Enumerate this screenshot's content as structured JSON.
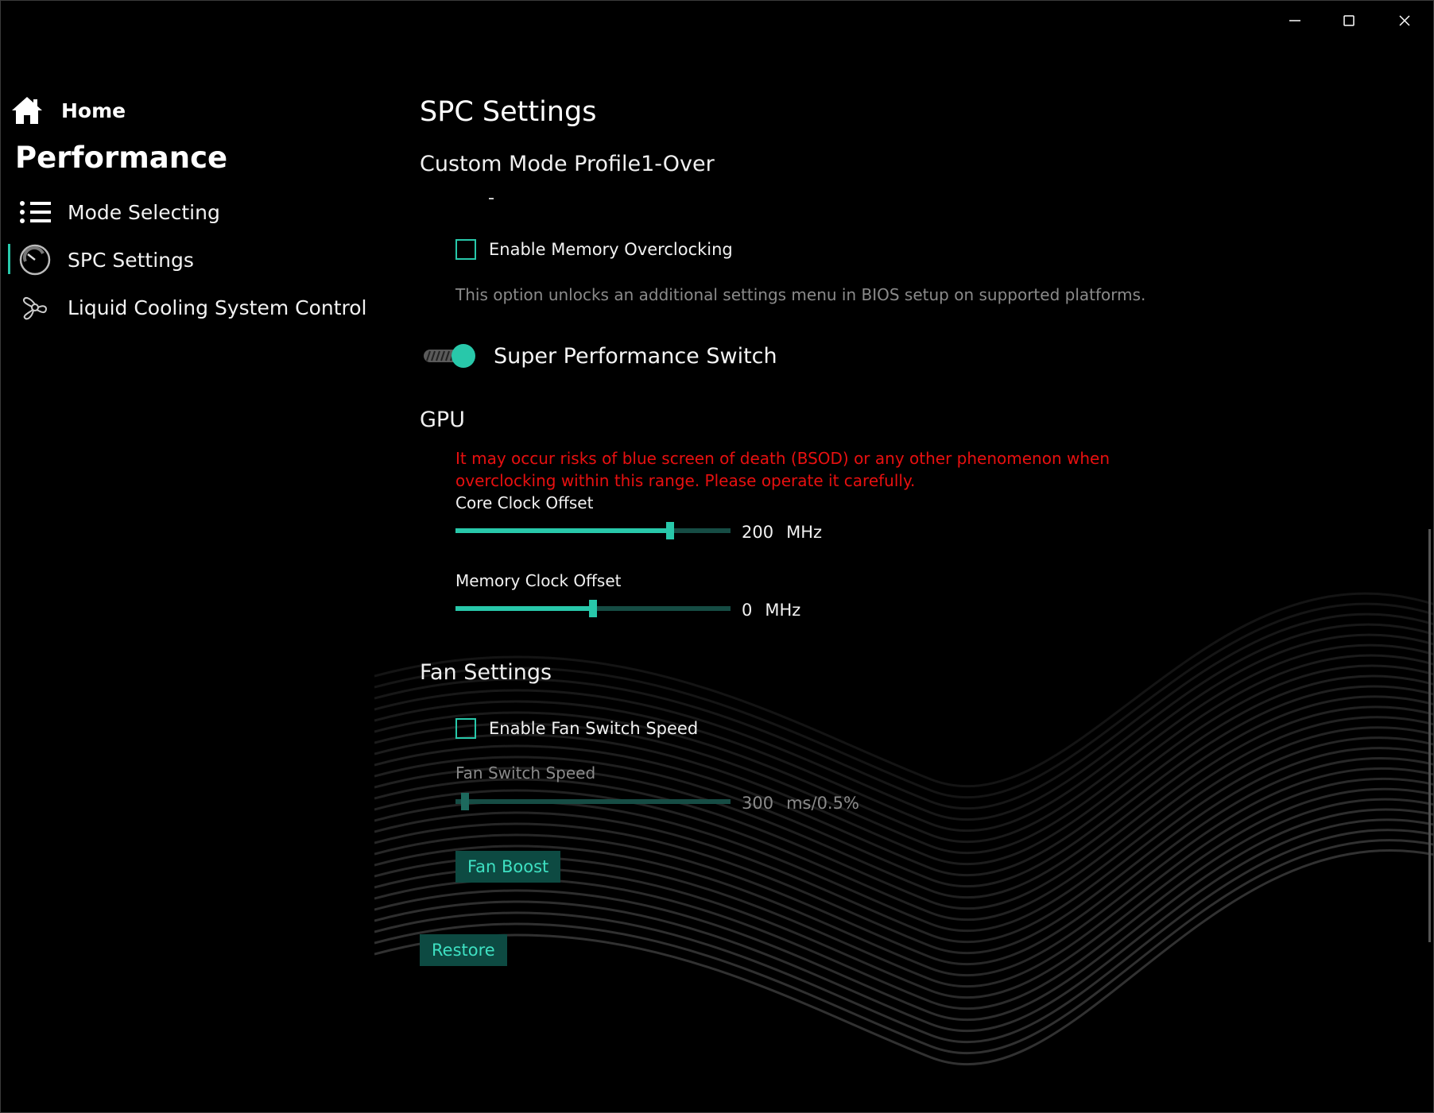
{
  "window": {
    "controls": [
      "minimize",
      "maximize",
      "close"
    ]
  },
  "sidebar": {
    "home_label": "Home",
    "section_title": "Performance",
    "items": [
      {
        "label": "Mode Selecting",
        "icon": "list-icon"
      },
      {
        "label": "SPC Settings",
        "icon": "gauge-icon",
        "active": true
      },
      {
        "label": "Liquid Cooling System Control",
        "icon": "fan-icon"
      }
    ]
  },
  "main": {
    "title": "SPC Settings",
    "subtitle": "Custom Mode Profile1-Over",
    "memory_oc": {
      "label": "Enable Memory Overclocking",
      "checked": false,
      "hint": "This option unlocks an additional settings menu in BIOS setup on supported platforms."
    },
    "super_switch": {
      "label": "Super Performance Switch",
      "on": true
    },
    "gpu": {
      "heading": "GPU",
      "warning": "It may occur risks of blue screen of death (BSOD) or any other phenomenon when overclocking within this range. Please operate it carefully.",
      "core_clock": {
        "label": "Core Clock Offset",
        "value": "200",
        "unit": "MHz",
        "fraction": 0.79
      },
      "memory_clock": {
        "label": "Memory Clock Offset",
        "value": "0",
        "unit": "MHz",
        "fraction": 0.5
      }
    },
    "fan": {
      "heading": "Fan Settings",
      "enable_label": "Enable Fan Switch Speed",
      "enable_checked": false,
      "speed": {
        "label": "Fan Switch Speed",
        "value": "300",
        "unit": "ms/0.5%",
        "fraction": 0.02
      },
      "boost_label": "Fan Boost"
    },
    "restore_label": "Restore"
  },
  "colors": {
    "accent": "#28c8aa",
    "warning": "#e81010",
    "button_bg": "#0d4a42"
  }
}
